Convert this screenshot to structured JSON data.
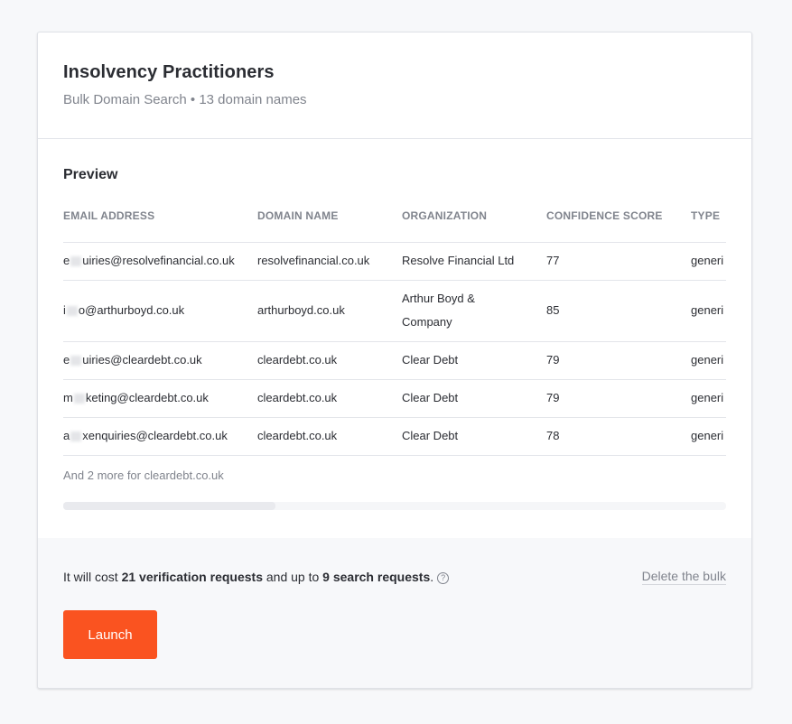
{
  "header": {
    "title": "Insolvency Practitioners",
    "subtitle": "Bulk Domain Search • 13 domain names"
  },
  "preview": {
    "title": "Preview",
    "columns": [
      "EMAIL ADDRESS",
      "DOMAIN NAME",
      "ORGANIZATION",
      "CONFIDENCE SCORE",
      "TYPE"
    ],
    "rows": [
      {
        "email_prefix": "e",
        "email_suffix": "uiries@resolvefinancial.co.uk",
        "domain": "resolvefinancial.co.uk",
        "organization": "Resolve Financial Ltd",
        "score": "77",
        "type": "generi"
      },
      {
        "email_prefix": "i",
        "email_suffix": "o@arthurboyd.co.uk",
        "domain": "arthurboyd.co.uk",
        "organization": "Arthur Boyd & Company",
        "score": "85",
        "type": "generi"
      },
      {
        "email_prefix": "e",
        "email_suffix": "uiries@cleardebt.co.uk",
        "domain": "cleardebt.co.uk",
        "organization": "Clear Debt",
        "score": "79",
        "type": "generi"
      },
      {
        "email_prefix": "m",
        "email_suffix": "keting@cleardebt.co.uk",
        "domain": "cleardebt.co.uk",
        "organization": "Clear Debt",
        "score": "79",
        "type": "generi"
      },
      {
        "email_prefix": "a",
        "email_suffix": "xenquiries@cleardebt.co.uk",
        "domain": "cleardebt.co.uk",
        "organization": "Clear Debt",
        "score": "78",
        "type": "generi"
      }
    ],
    "more_text": "And 2 more for cleardebt.co.uk",
    "horizontal_scroll_position": 0
  },
  "footer": {
    "cost_prefix": "It will cost ",
    "verification_requests": "21 verification requests",
    "cost_middle": " and up to ",
    "search_requests": "9 search requests",
    "cost_suffix": ".",
    "help_icon": "?",
    "delete_label": "Delete the bulk",
    "launch_label": "Launch"
  },
  "colors": {
    "accent": "#fa5320",
    "background": "#f7f8fa",
    "muted_text": "#80848d"
  }
}
